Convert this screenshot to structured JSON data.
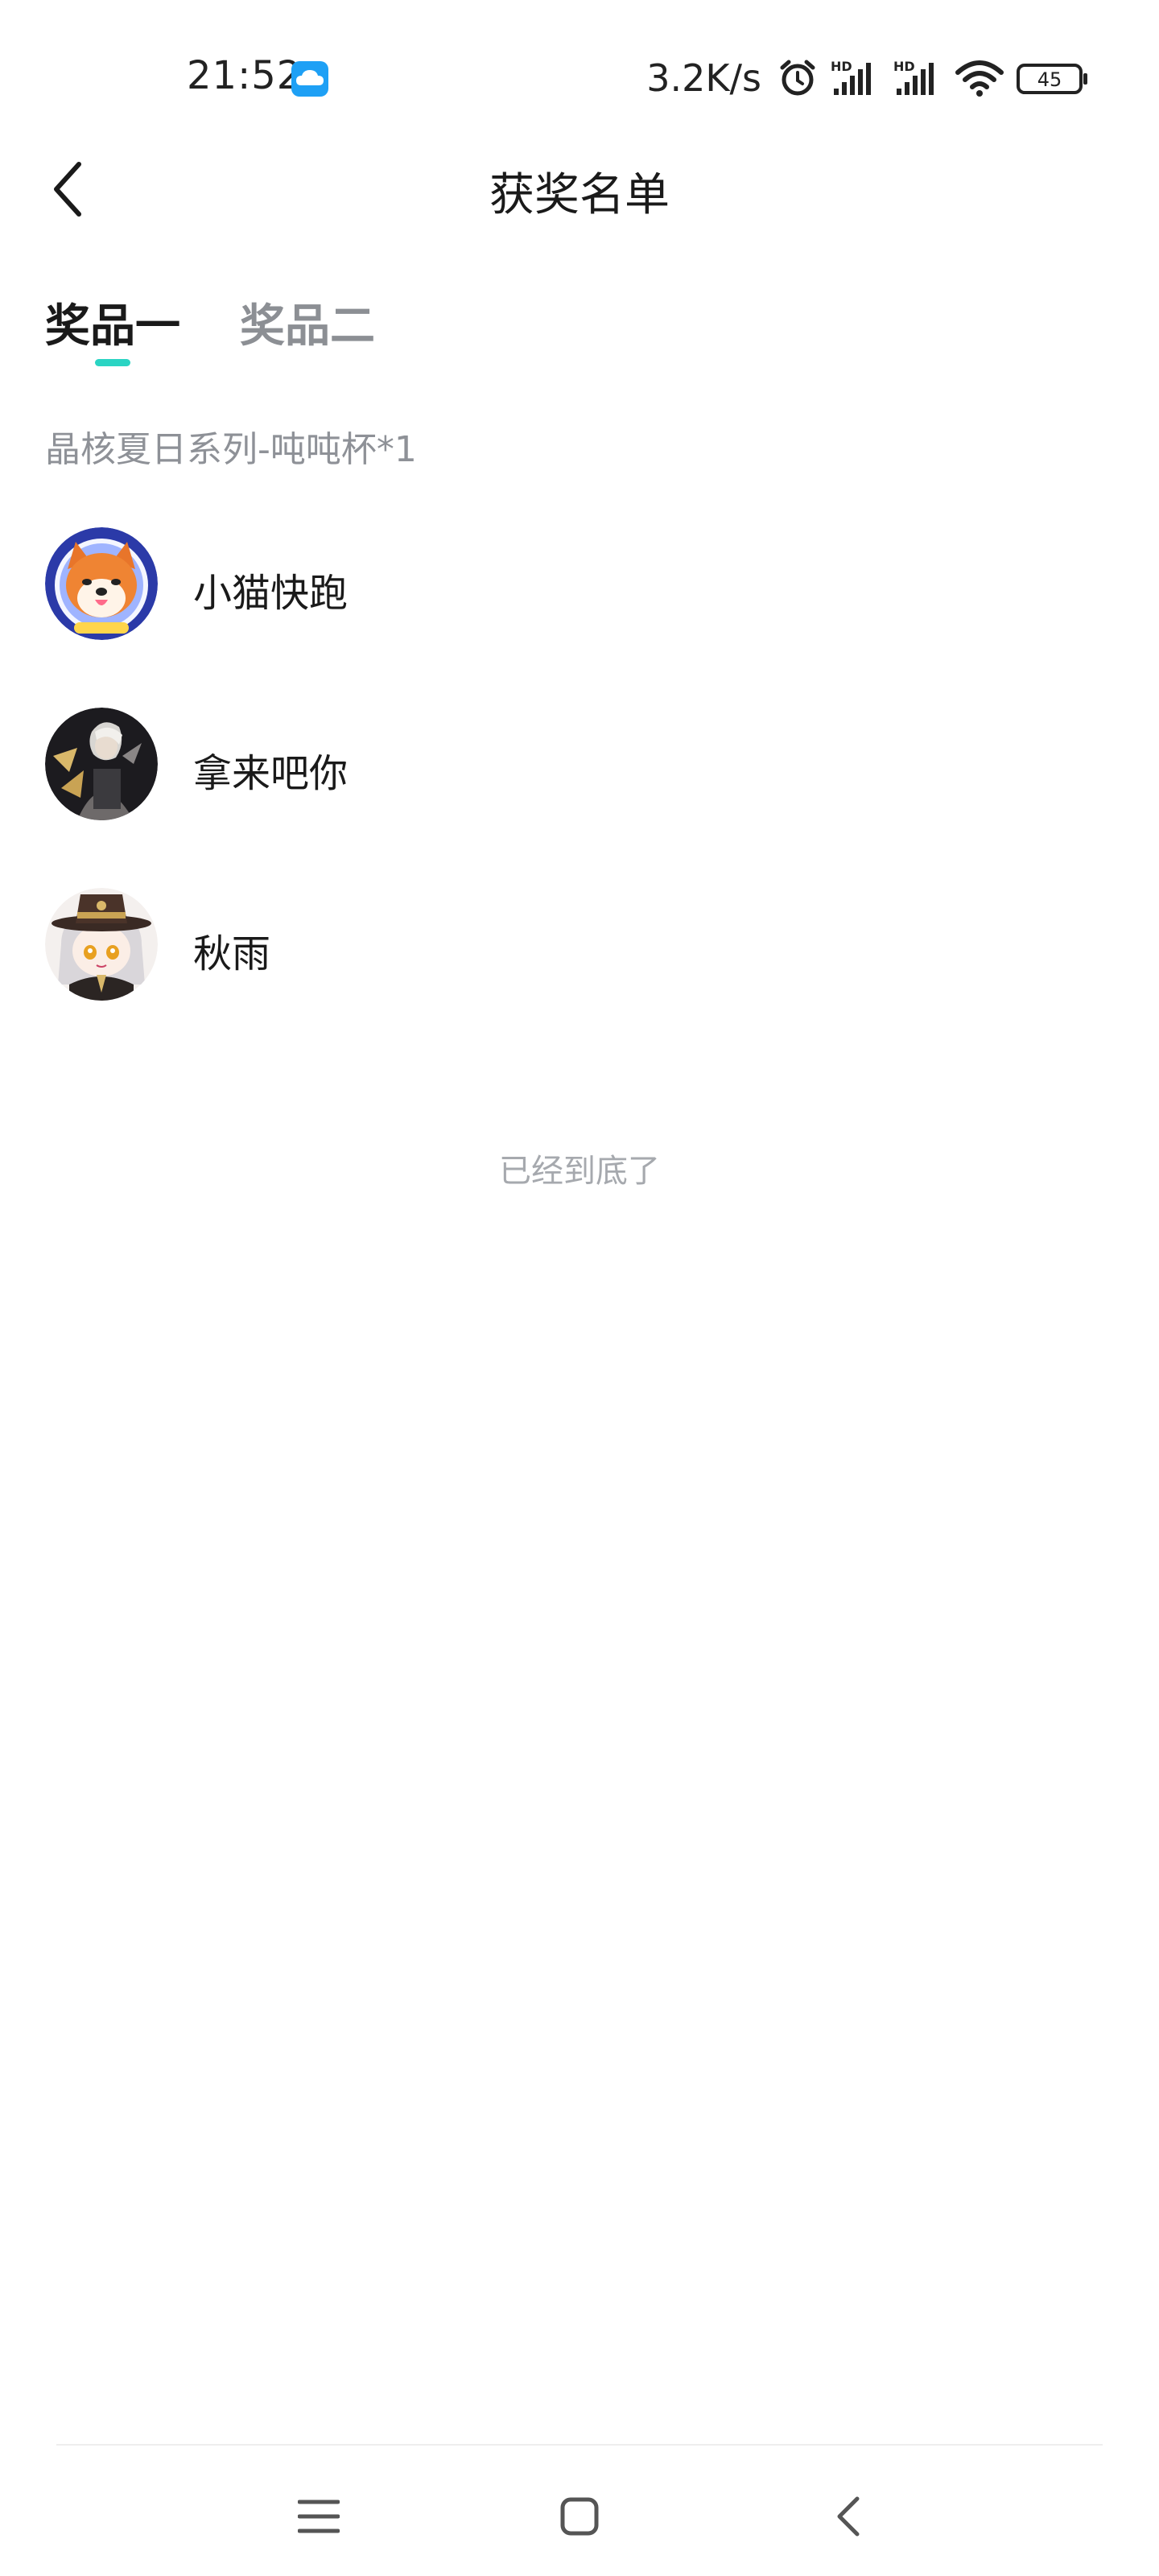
{
  "status_bar": {
    "time": "21:52",
    "net_speed": "3.2K/s",
    "battery": "45",
    "icons": [
      "cloud-app-icon",
      "alarm-icon",
      "signal-hd-icon",
      "signal-hd-icon",
      "wifi-icon",
      "battery-icon"
    ]
  },
  "header": {
    "title": "获奖名单",
    "back_icon": "chevron-left-icon"
  },
  "tabs": [
    {
      "label": "奖品一",
      "active": true
    },
    {
      "label": "奖品二",
      "active": false
    }
  ],
  "prize": {
    "description": "晶核夏日系列-吨吨杯*1"
  },
  "winners": [
    {
      "name": "小猫快跑",
      "avatar": "shiba-dog-avatar"
    },
    {
      "name": "拿来吧你",
      "avatar": "dark-knight-avatar"
    },
    {
      "name": "秋雨",
      "avatar": "anime-girl-hat-avatar"
    }
  ],
  "end_text": "已经到底了",
  "nav": {
    "icons": [
      "menu-icon",
      "home-icon",
      "back-icon"
    ]
  },
  "colors": {
    "accent": "#2ad4c3",
    "inactive_text": "#8c8f94"
  }
}
